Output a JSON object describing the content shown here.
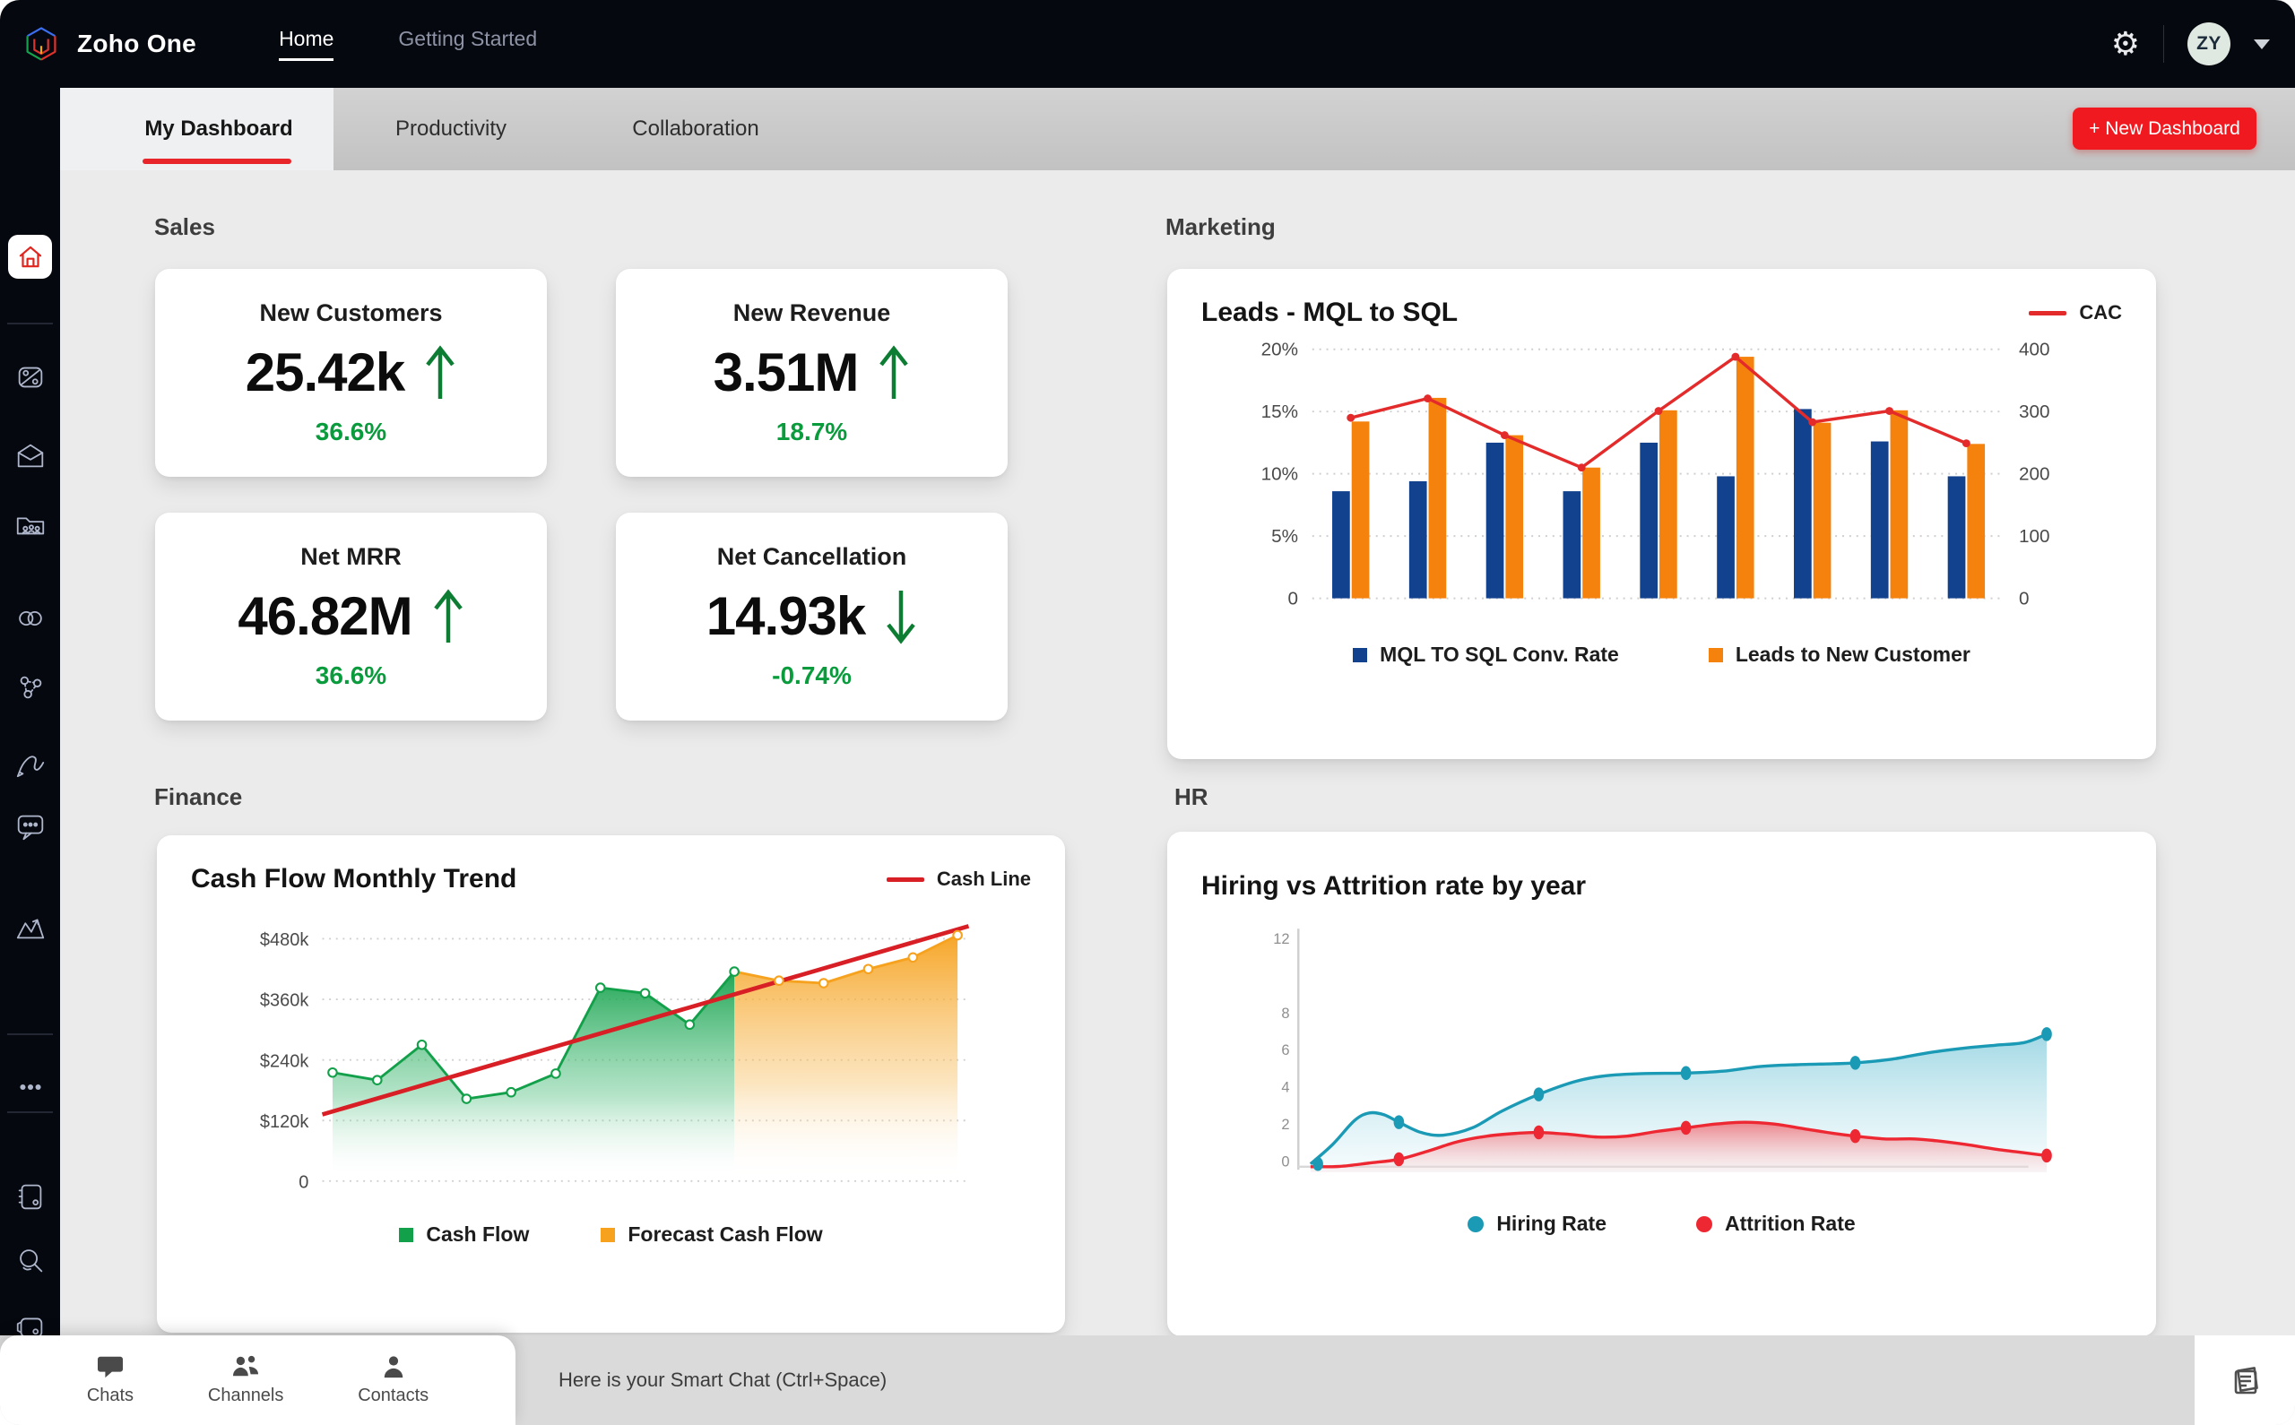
{
  "topbar": {
    "brand": "Zoho One",
    "nav": [
      {
        "label": "Home",
        "active": true
      },
      {
        "label": "Getting Started",
        "active": false
      }
    ],
    "icons": [
      "zoho-one-logo",
      "gear-icon",
      "caret-down-icon"
    ],
    "avatar_initials": "ZY"
  },
  "tabstrip": {
    "tabs": [
      {
        "label": "My Dashboard",
        "active": true
      },
      {
        "label": "Productivity",
        "active": false
      },
      {
        "label": "Collaboration",
        "active": false
      }
    ],
    "new_dashboard_label": "+ New Dashboard"
  },
  "sidebar": {
    "icons": [
      "home-icon",
      "crm-disc-icon",
      "mail-icon",
      "folder-team-icon",
      "links-icon",
      "network-icon",
      "sign-icon",
      "chat-icon",
      "analytics-icon",
      "more-dots-icon",
      "journal-icon",
      "search-icon",
      "wallet-icon"
    ]
  },
  "sections": {
    "sales": "Sales",
    "marketing": "Marketing",
    "finance": "Finance",
    "hr": "HR"
  },
  "kpis": [
    {
      "title": "New Customers",
      "value": "25.42k",
      "direction": "up",
      "change": "36.6%"
    },
    {
      "title": "New Revenue",
      "value": "3.51M",
      "direction": "up",
      "change": "18.7%"
    },
    {
      "title": "Net MRR",
      "value": "46.82M",
      "direction": "up",
      "change": "36.6%"
    },
    {
      "title": "Net Cancellation",
      "value": "14.93k",
      "direction": "down",
      "change": "-0.74%"
    }
  ],
  "chart_data": [
    {
      "id": "marketing",
      "type": "bar-line-dual",
      "title": "Leads - MQL to SQL",
      "top_legend": {
        "label": "CAC",
        "color": "#e42b2b"
      },
      "left_axis": {
        "ticks": [
          "20%",
          "15%",
          "10%",
          "5%",
          "0"
        ],
        "tick_values": [
          20,
          15,
          10,
          5,
          0
        ],
        "max": 20
      },
      "right_axis": {
        "ticks": [
          "400",
          "300",
          "200",
          "100",
          "0"
        ],
        "tick_values": [
          400,
          300,
          200,
          100,
          0
        ],
        "max": 400
      },
      "x_labels": [],
      "grid": "dotted",
      "series": [
        {
          "name": "MQL TO SQL Conv. Rate",
          "type": "bar",
          "axis": "left",
          "color": "#12418e",
          "values": [
            8.6,
            9.4,
            12.5,
            8.6,
            12.5,
            9.8,
            15.2,
            12.6,
            9.8
          ]
        },
        {
          "name": "Leads to New Customer",
          "type": "bar",
          "axis": "left",
          "color": "#f5820d",
          "values": [
            14.2,
            16.1,
            13.1,
            10.5,
            15.1,
            19.4,
            14.1,
            15.1,
            12.4
          ]
        },
        {
          "name": "CAC",
          "type": "line",
          "axis": "right",
          "color": "#e42b2b",
          "values": [
            290,
            321,
            262,
            210,
            301,
            388,
            283,
            301,
            249
          ]
        }
      ]
    },
    {
      "id": "finance",
      "type": "area-trend",
      "title": "Cash Flow Monthly Trend",
      "top_legend": {
        "label": "Cash Line",
        "color": "#d91f26"
      },
      "y_axis": {
        "ticks": [
          "$480k",
          "$360k",
          "$240k",
          "$120k",
          "0"
        ],
        "tick_values": [
          480,
          360,
          240,
          120,
          0
        ],
        "max": 520
      },
      "grid": "dotted",
      "series": [
        {
          "name": "Cash Flow",
          "type": "area",
          "color": "#13a04a",
          "values": [
            215,
            200,
            270,
            163,
            176,
            213,
            383,
            372,
            310,
            415
          ]
        },
        {
          "name": "Forecast Cash Flow",
          "type": "area",
          "color": "#f6a21e",
          "starts_at_index": 9,
          "values": [
            415,
            397,
            392,
            420,
            443,
            487
          ]
        },
        {
          "name": "Cash Line",
          "type": "trend",
          "color": "#d91f26",
          "start_value": 132,
          "end_value": 505
        }
      ]
    },
    {
      "id": "hr",
      "type": "smooth-area",
      "title": "Hiring vs Attrition rate by year",
      "y_axis": {
        "ticks": [
          "12",
          "8",
          "6",
          "4",
          "2",
          "0"
        ],
        "tick_values": [
          12,
          8,
          6,
          4,
          2,
          0
        ],
        "min": -0.6,
        "max": 13
      },
      "series": [
        {
          "name": "Hiring Rate",
          "color": "#1b9ab5",
          "curve": [
            [
              0,
              -0.15
            ],
            [
              0.03,
              0.9
            ],
            [
              0.06,
              2.2
            ],
            [
              0.08,
              2.6
            ],
            [
              0.1,
              2.5
            ],
            [
              0.12,
              2.1
            ],
            [
              0.15,
              1.55
            ],
            [
              0.18,
              1.4
            ],
            [
              0.22,
              1.8
            ],
            [
              0.26,
              2.7
            ],
            [
              0.31,
              3.6
            ],
            [
              0.36,
              4.3
            ],
            [
              0.4,
              4.6
            ],
            [
              0.45,
              4.72
            ],
            [
              0.51,
              4.75
            ],
            [
              0.56,
              4.85
            ],
            [
              0.61,
              5.1
            ],
            [
              0.66,
              5.2
            ],
            [
              0.71,
              5.25
            ],
            [
              0.74,
              5.3
            ],
            [
              0.79,
              5.5
            ],
            [
              0.84,
              5.85
            ],
            [
              0.89,
              6.1
            ],
            [
              0.93,
              6.25
            ],
            [
              0.97,
              6.4
            ],
            [
              1,
              6.85
            ]
          ],
          "markers": [
            [
              0.01,
              -0.15
            ],
            [
              0.12,
              2.1
            ],
            [
              0.31,
              3.6
            ],
            [
              0.51,
              4.75
            ],
            [
              0.74,
              5.3
            ],
            [
              1,
              6.85
            ]
          ]
        },
        {
          "name": "Attrition Rate",
          "color": "#ee2832",
          "curve": [
            [
              0,
              -0.3
            ],
            [
              0.04,
              -0.28
            ],
            [
              0.08,
              -0.1
            ],
            [
              0.12,
              0.1
            ],
            [
              0.16,
              0.55
            ],
            [
              0.2,
              1.05
            ],
            [
              0.24,
              1.35
            ],
            [
              0.28,
              1.5
            ],
            [
              0.31,
              1.55
            ],
            [
              0.35,
              1.45
            ],
            [
              0.39,
              1.3
            ],
            [
              0.43,
              1.35
            ],
            [
              0.47,
              1.6
            ],
            [
              0.51,
              1.8
            ],
            [
              0.55,
              2.0
            ],
            [
              0.59,
              2.1
            ],
            [
              0.63,
              2.0
            ],
            [
              0.67,
              1.75
            ],
            [
              0.71,
              1.5
            ],
            [
              0.74,
              1.35
            ],
            [
              0.78,
              1.2
            ],
            [
              0.82,
              1.2
            ],
            [
              0.85,
              1.1
            ],
            [
              0.89,
              0.9
            ],
            [
              0.93,
              0.65
            ],
            [
              0.97,
              0.45
            ],
            [
              1,
              0.3
            ]
          ],
          "markers": [
            [
              0.12,
              0.1
            ],
            [
              0.31,
              1.55
            ],
            [
              0.51,
              1.8
            ],
            [
              0.74,
              1.35
            ],
            [
              1,
              0.3
            ]
          ]
        }
      ]
    }
  ],
  "bottombar": {
    "tabs": [
      {
        "label": "Chats",
        "icon": "chat-bubble-icon"
      },
      {
        "label": "Channels",
        "icon": "people-icon"
      },
      {
        "label": "Contacts",
        "icon": "person-icon"
      }
    ],
    "smart_chat_placeholder": "Here is your Smart Chat (Ctrl+Space)",
    "right_icon": "notes-icon"
  },
  "colors": {
    "accent_red": "#f0191f",
    "kpi_green": "#0a9b3d",
    "bar_blue": "#12418e",
    "bar_orange": "#f5820d",
    "line_red": "#e42b2b",
    "hiring_teal": "#1b9ab5",
    "attrition_red": "#ee2832",
    "cash_green": "#13a04a",
    "forecast_orange": "#f6a21e"
  }
}
